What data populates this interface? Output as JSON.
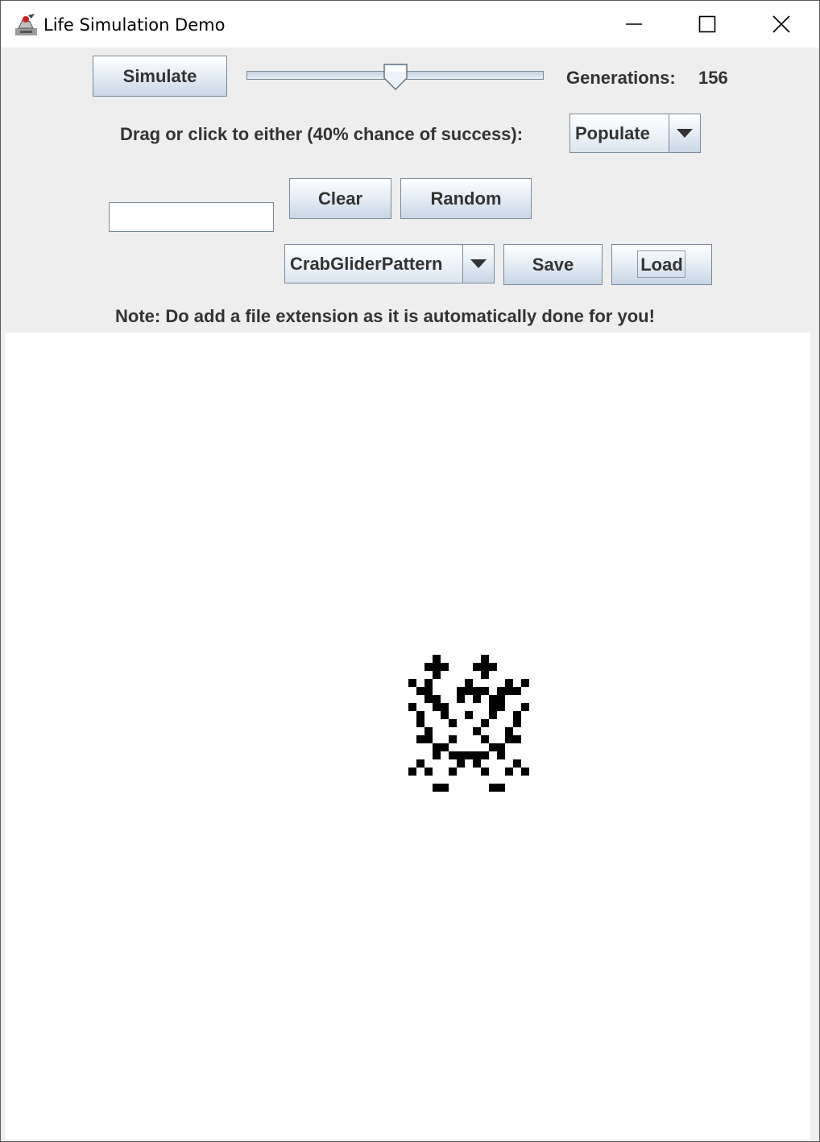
{
  "window": {
    "title": "Life Simulation Demo",
    "controls": [
      "minimize-icon",
      "maximize-icon",
      "close-icon"
    ]
  },
  "toolbar": {
    "simulate_label": "Simulate",
    "speed_slider": {
      "fraction": 0.5
    },
    "generations_label": "Generations:",
    "generations_value": "156"
  },
  "mode": {
    "label": "Drag or click to either (40% chance of success):",
    "selected": "Populate"
  },
  "actions": {
    "clear_label": "Clear",
    "random_label": "Random"
  },
  "file": {
    "filename_value": "",
    "pattern_selected": "CrabGliderPattern",
    "save_label": "Save",
    "load_label": "Load",
    "note": "Note: Do add a file extension as it is automatically done for you!"
  },
  "grid": {
    "cell_color": "#000000",
    "background_color": "#ffffff",
    "live_cells": [
      [
        8,
        3
      ],
      [
        14,
        3
      ],
      [
        7,
        4
      ],
      [
        8,
        4
      ],
      [
        9,
        4
      ],
      [
        13,
        4
      ],
      [
        14,
        4
      ],
      [
        15,
        4
      ],
      [
        8,
        5
      ],
      [
        14,
        5
      ],
      [
        5,
        6
      ],
      [
        7,
        6
      ],
      [
        12,
        6
      ],
      [
        17,
        6
      ],
      [
        19,
        6
      ],
      [
        6,
        7
      ],
      [
        7,
        7
      ],
      [
        11,
        7
      ],
      [
        12,
        7
      ],
      [
        13,
        7
      ],
      [
        14,
        7
      ],
      [
        16,
        7
      ],
      [
        17,
        7
      ],
      [
        18,
        7
      ],
      [
        7,
        8
      ],
      [
        8,
        8
      ],
      [
        11,
        8
      ],
      [
        13,
        8
      ],
      [
        15,
        8
      ],
      [
        16,
        8
      ],
      [
        5,
        9
      ],
      [
        8,
        9
      ],
      [
        9,
        9
      ],
      [
        15,
        9
      ],
      [
        16,
        9
      ],
      [
        19,
        9
      ],
      [
        6,
        10
      ],
      [
        9,
        10
      ],
      [
        12,
        10
      ],
      [
        15,
        10
      ],
      [
        18,
        10
      ],
      [
        6,
        11
      ],
      [
        10,
        11
      ],
      [
        14,
        11
      ],
      [
        18,
        11
      ],
      [
        7,
        12
      ],
      [
        13,
        12
      ],
      [
        17,
        12
      ],
      [
        6,
        13
      ],
      [
        7,
        13
      ],
      [
        10,
        13
      ],
      [
        14,
        13
      ],
      [
        17,
        13
      ],
      [
        18,
        13
      ],
      [
        8,
        14
      ],
      [
        9,
        14
      ],
      [
        15,
        14
      ],
      [
        16,
        14
      ],
      [
        8,
        15
      ],
      [
        10,
        15
      ],
      [
        11,
        15
      ],
      [
        12,
        15
      ],
      [
        13,
        15
      ],
      [
        14,
        15
      ],
      [
        16,
        15
      ],
      [
        6,
        16
      ],
      [
        11,
        16
      ],
      [
        13,
        16
      ],
      [
        18,
        16
      ],
      [
        5,
        17
      ],
      [
        7,
        17
      ],
      [
        10,
        17
      ],
      [
        14,
        17
      ],
      [
        17,
        17
      ],
      [
        19,
        17
      ],
      [
        8,
        19
      ],
      [
        9,
        19
      ],
      [
        15,
        19
      ],
      [
        16,
        19
      ]
    ]
  }
}
